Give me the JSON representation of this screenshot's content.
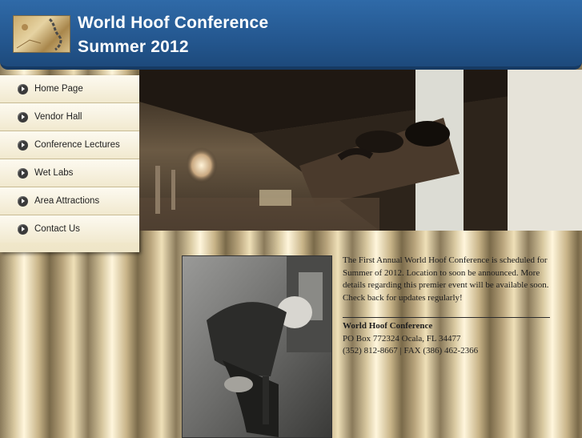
{
  "header": {
    "title_line1": "World Hoof Conference",
    "title_line2": "Summer 2012"
  },
  "nav": {
    "items": [
      {
        "label": "Home Page"
      },
      {
        "label": "Vendor Hall"
      },
      {
        "label": "Conference Lectures"
      },
      {
        "label": "Wet Labs"
      },
      {
        "label": "Area Attractions"
      },
      {
        "label": "Contact Us"
      }
    ]
  },
  "main": {
    "intro_text": "The First Annual World Hoof Conference is scheduled for Summer of 2012.  Location to soon be announced.  More details regarding this premier event will be available soon. Check back for updates regularly!",
    "contact": {
      "org": "World Hoof Conference",
      "address": "PO Box 772324 Ocala, FL 34477",
      "phone_fax": "(352) 812-8667 | FAX (386) 462-2366"
    }
  },
  "colors": {
    "header_blue": "#24578f",
    "nav_bg": "#f5efd9"
  }
}
